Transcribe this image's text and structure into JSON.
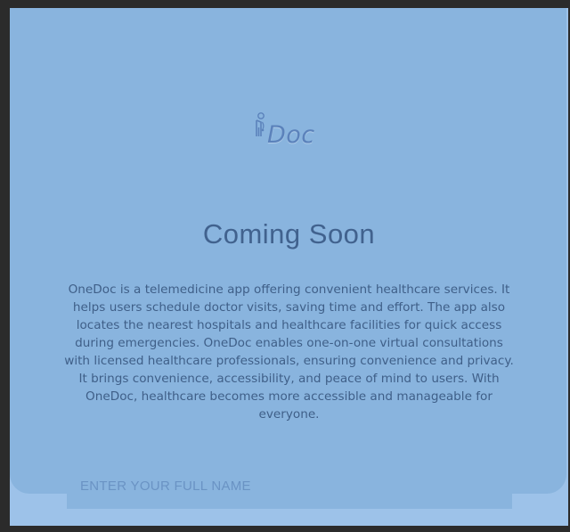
{
  "logo": {
    "text": "Doc",
    "icon": "doctor-stethoscope-icon",
    "color": "#5b82bb"
  },
  "page": {
    "title": "Coming Soon",
    "description": "OneDoc is a telemedicine app offering convenient healthcare services. It helps users schedule doctor visits, saving time and effort. The app also locates the nearest hospitals and healthcare facilities for quick access during emergencies. OneDoc enables one-on-one virtual consultations with licensed healthcare professionals, ensuring convenience and privacy. It brings convenience, accessibility, and peace of mind to users. With OneDoc, healthcare becomes more accessible and manageable for everyone."
  },
  "form": {
    "name_placeholder": "ENTER YOUR FULL NAME",
    "name_value": ""
  },
  "colors": {
    "background": "#9dc2e9",
    "card": "#89b4de",
    "text": "#3f5f88",
    "frame": "#2b2b2b"
  }
}
